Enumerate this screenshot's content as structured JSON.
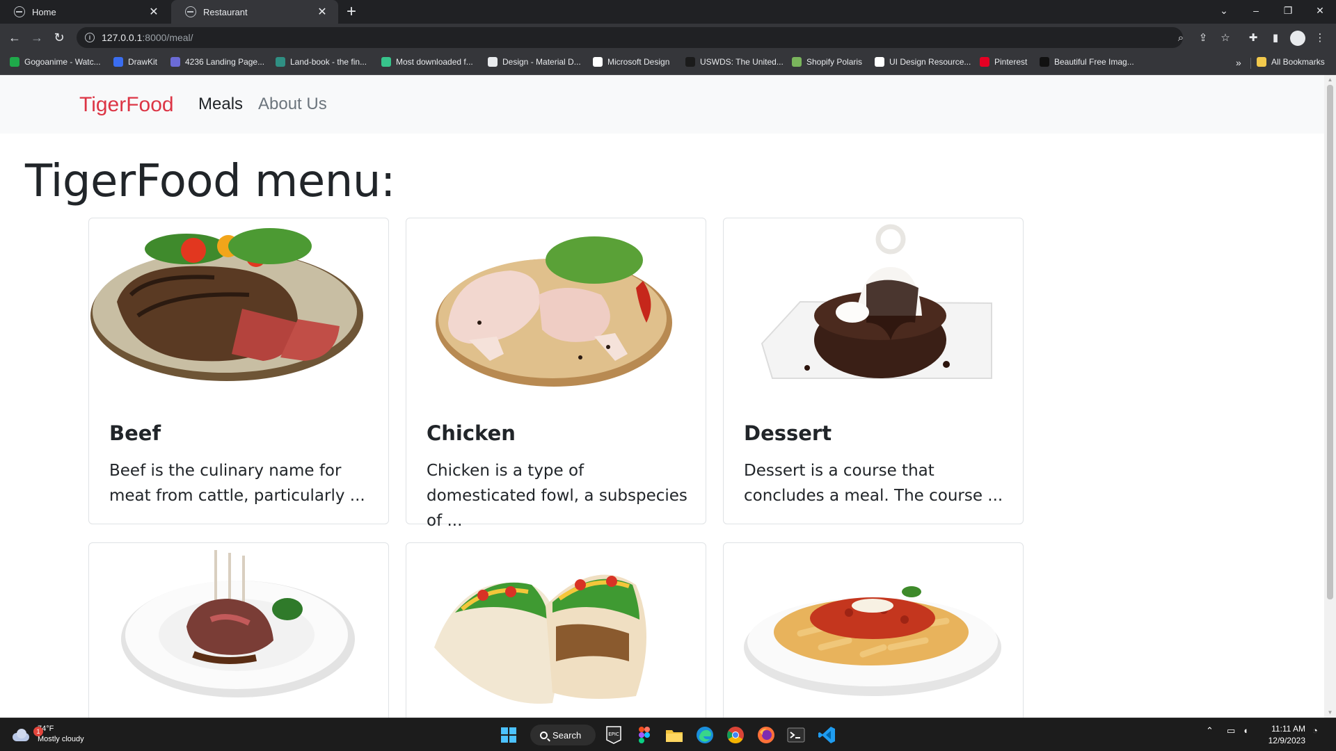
{
  "browser": {
    "tabs": [
      {
        "title": "Home",
        "active": false
      },
      {
        "title": "Restaurant",
        "active": true
      }
    ],
    "url_host": "127.0.0.1",
    "url_path": ":8000/meal/",
    "bookmarks": [
      {
        "label": "Gogoanime - Watc...",
        "color": "#1fa94a"
      },
      {
        "label": "DrawKit",
        "color": "#3a6df0"
      },
      {
        "label": "4236 Landing Page...",
        "color": "#6b6bd6"
      },
      {
        "label": "Land-book - the fin...",
        "color": "#2f8f83"
      },
      {
        "label": "Most downloaded f...",
        "color": "#37c48b"
      },
      {
        "label": "Design - Material D...",
        "color": "#e8eaed"
      },
      {
        "label": "Microsoft Design",
        "color": "#ffffff"
      },
      {
        "label": "USWDS: The United...",
        "color": "#1b1b1b"
      },
      {
        "label": "Shopify Polaris",
        "color": "#7ab55c"
      },
      {
        "label": "UI Design Resource...",
        "color": "#ffffff"
      },
      {
        "label": "Pinterest",
        "color": "#e60023"
      },
      {
        "label": "Beautiful Free Imag...",
        "color": "#111111"
      }
    ],
    "all_bookmarks": "All Bookmarks"
  },
  "site": {
    "brand": "TigerFood",
    "nav": [
      {
        "label": "Meals",
        "active": true
      },
      {
        "label": "About Us",
        "active": false
      }
    ],
    "heading": "TigerFood menu:",
    "meals": [
      {
        "title": "Beef",
        "text": "Beef is the culinary name for meat from cattle, particularly ...",
        "image": "beef-steak"
      },
      {
        "title": "Chicken",
        "text": "Chicken is a type of domesticated fowl, a subspecies of ...",
        "image": "raw-chicken"
      },
      {
        "title": "Dessert",
        "text": "Dessert is a course that concludes a meal. The course ...",
        "image": "chocolate-dessert"
      },
      {
        "title": "",
        "text": "",
        "image": "lamb-chops"
      },
      {
        "title": "",
        "text": "",
        "image": "tacos"
      },
      {
        "title": "",
        "text": "",
        "image": "penne-pasta"
      }
    ]
  },
  "taskbar": {
    "temperature": "74°F",
    "condition": "Mostly cloudy",
    "weather_badge": "1",
    "search_label": "Search",
    "time": "11:11 AM",
    "date": "12/9/2023"
  },
  "colors": {
    "brand": "#dc3545",
    "navbar_bg": "#f8f9fa",
    "chrome_dark": "#202124",
    "chrome_toolbar": "#35363a"
  }
}
